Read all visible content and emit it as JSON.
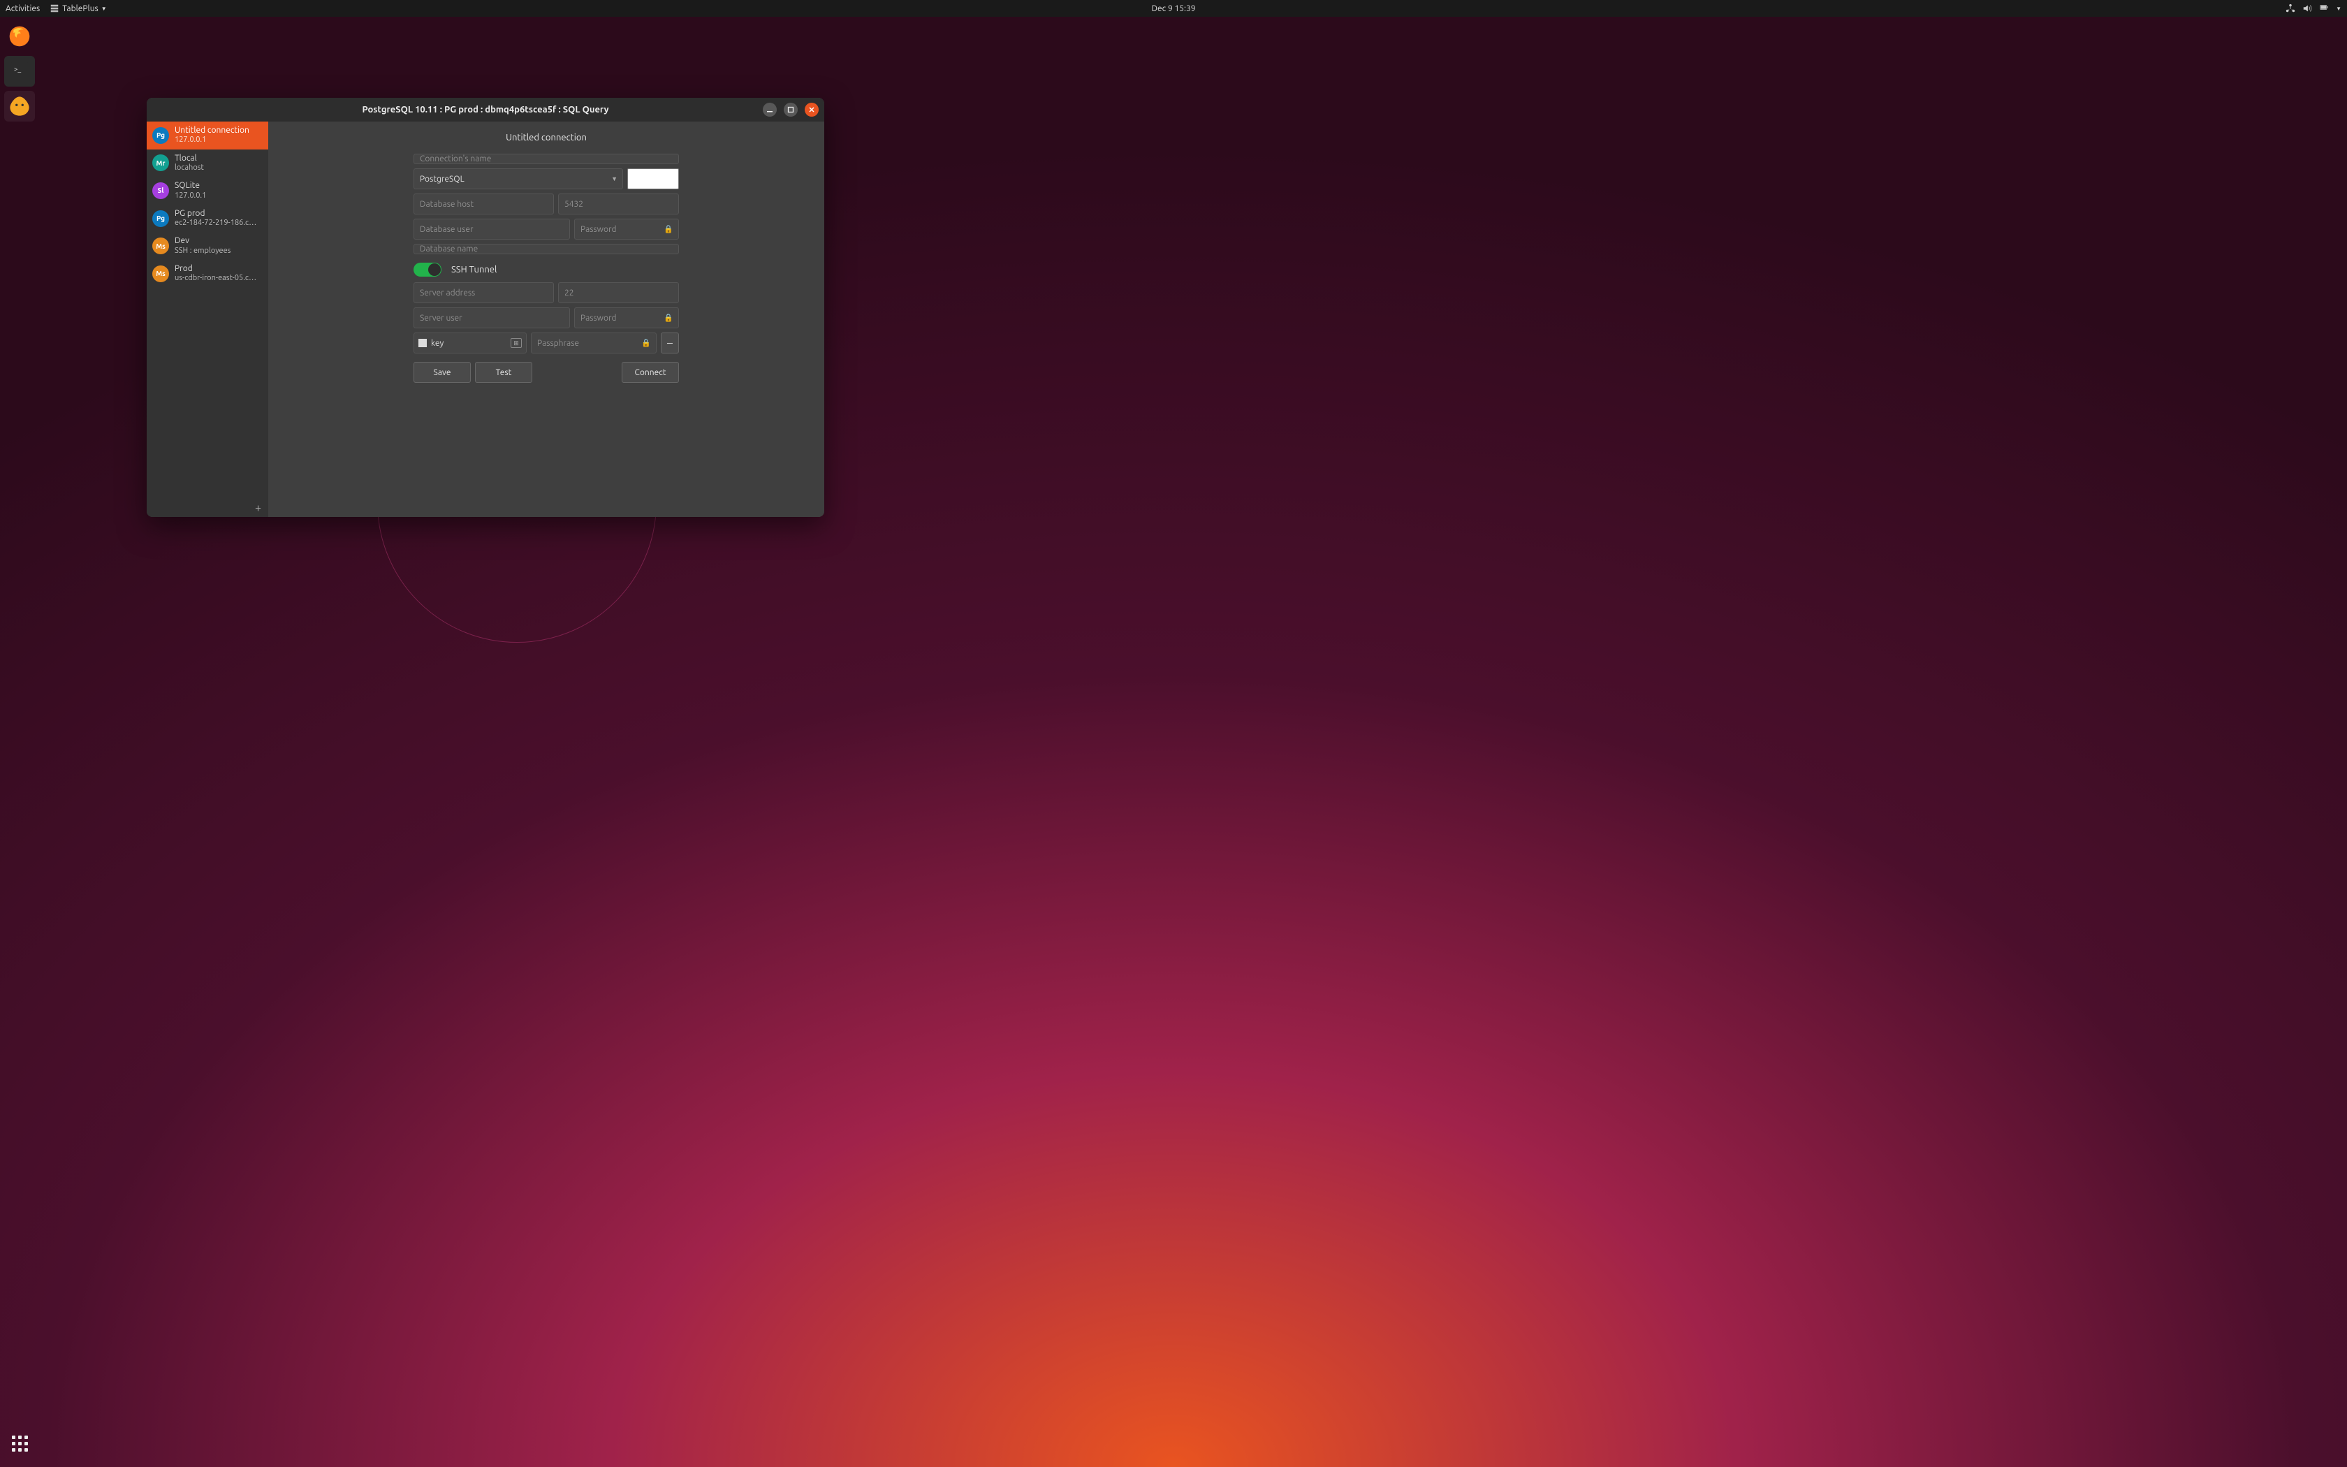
{
  "topbar": {
    "activities": "Activities",
    "app_name": "TablePlus",
    "clock": "Dec 9  15:39"
  },
  "dock": {
    "items": [
      "firefox",
      "terminal",
      "tableplus"
    ]
  },
  "window": {
    "title": "PostgreSQL 10.11   :  PG prod  :  dbmq4p6tscea5f  :  SQL Query"
  },
  "sidebar": {
    "connections": [
      {
        "badge": "Pg",
        "cls": "pg",
        "name": "Untitled connection",
        "sub": "127.0.0.1",
        "active": true
      },
      {
        "badge": "Mr",
        "cls": "mr",
        "name": "Tlocal",
        "sub": "locahost",
        "active": false
      },
      {
        "badge": "Sl",
        "cls": "sl",
        "name": "SQLite",
        "sub": "127.0.0.1",
        "active": false
      },
      {
        "badge": "Pg",
        "cls": "pg",
        "name": "PG prod",
        "sub": "ec2-184-72-219-186.c…",
        "active": false
      },
      {
        "badge": "Ms",
        "cls": "ms",
        "name": "Dev",
        "sub": "SSH : employees",
        "active": false
      },
      {
        "badge": "Ms",
        "cls": "ms",
        "name": "Prod",
        "sub": "us-cdbr-iron-east-05.c…",
        "active": false
      }
    ],
    "add_icon": "+"
  },
  "form": {
    "title": "Untitled connection",
    "name_ph": "Connection's name",
    "driver": "PostgreSQL",
    "color": "#ffffff",
    "host_ph": "Database host",
    "port_ph": "5432",
    "user_ph": "Database user",
    "pass_ph": "Password",
    "dbname_ph": "Database name",
    "ssh_label": "SSH Tunnel",
    "ssh_enabled": true,
    "ssh_host_ph": "Server address",
    "ssh_port_ph": "22",
    "ssh_user_ph": "Server user",
    "ssh_pass_ph": "Password",
    "key_label": "key",
    "passphrase_ph": "Passphrase",
    "minus_label": "–",
    "save_label": "Save",
    "test_label": "Test",
    "connect_label": "Connect"
  }
}
